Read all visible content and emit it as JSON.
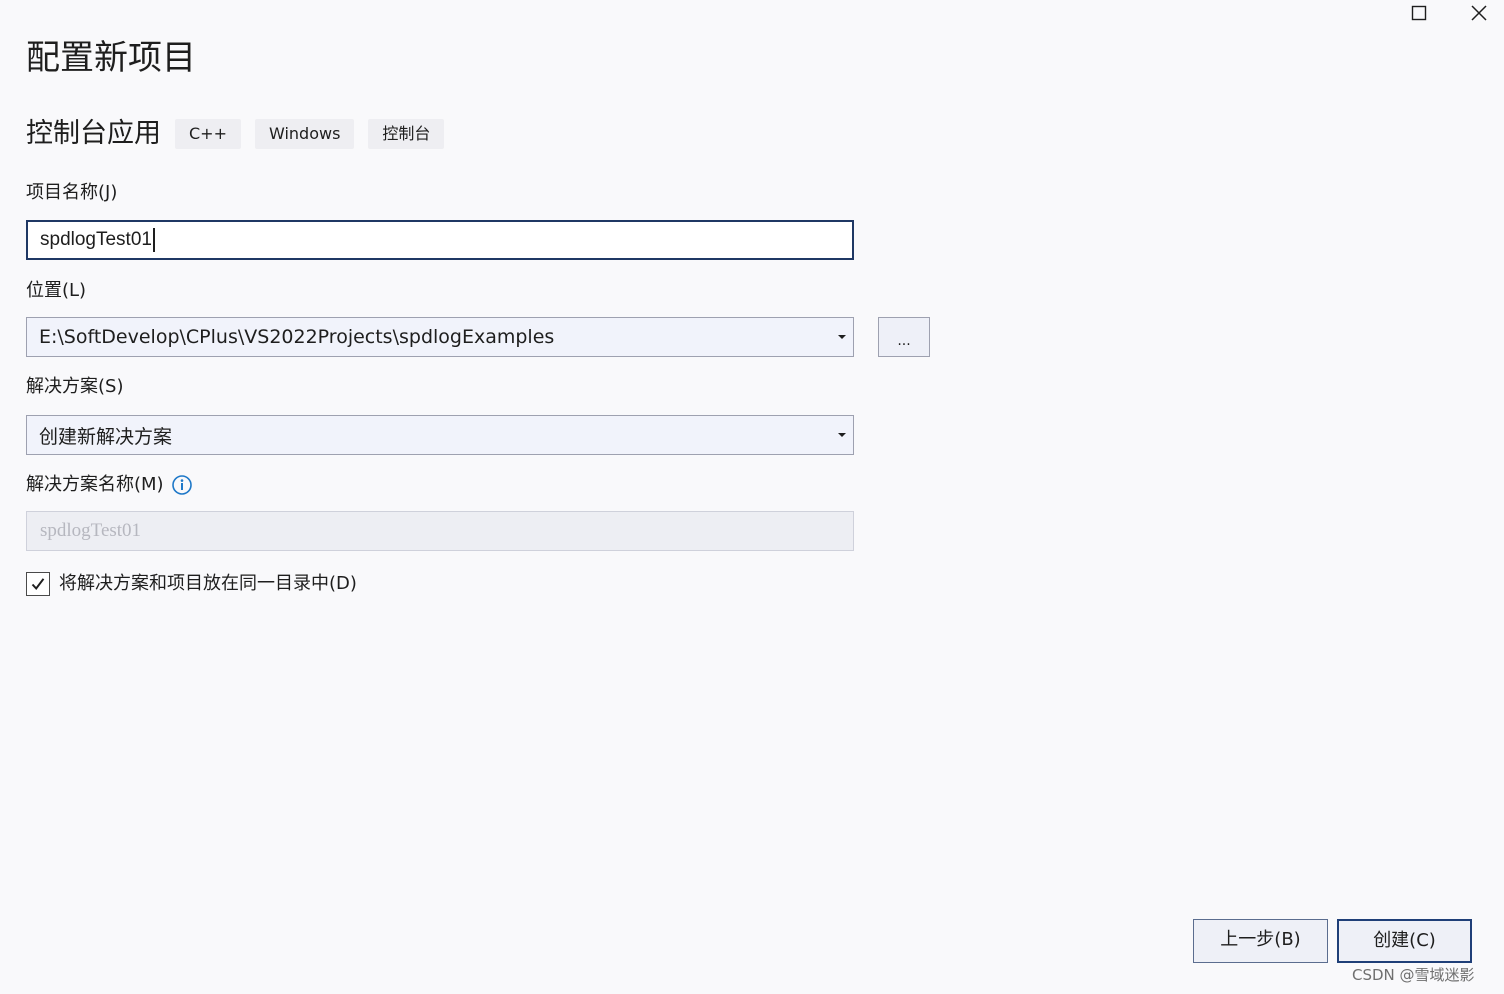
{
  "dialog": {
    "title": "配置新项目",
    "template": {
      "name": "控制台应用",
      "tags": [
        "C++",
        "Windows",
        "控制台"
      ]
    },
    "project_name": {
      "label": "项目名称(J)",
      "value": "spdlogTest01"
    },
    "location": {
      "label": "位置(L)",
      "value": "E:\\SoftDevelop\\CPlus\\VS2022Projects\\spdlogExamples",
      "browse_label": "..."
    },
    "solution": {
      "label": "解决方案(S)",
      "value": "创建新解决方案"
    },
    "solution_name": {
      "label": "解决方案名称(M)",
      "value": "spdlogTest01",
      "info_icon": "info-icon"
    },
    "same_directory": {
      "label": "将解决方案和项目放在同一目录中(D)",
      "checked": true
    },
    "buttons": {
      "back": "上一步(B)",
      "create": "创建(C)"
    }
  },
  "window_controls": {
    "maximize_icon": "maximize-icon",
    "close_icon": "close-icon"
  },
  "watermark": "CSDN @雪域迷影",
  "colors": {
    "background": "#f9f9fb",
    "focus_border": "#1f3864",
    "info_blue": "#1e78c8"
  }
}
